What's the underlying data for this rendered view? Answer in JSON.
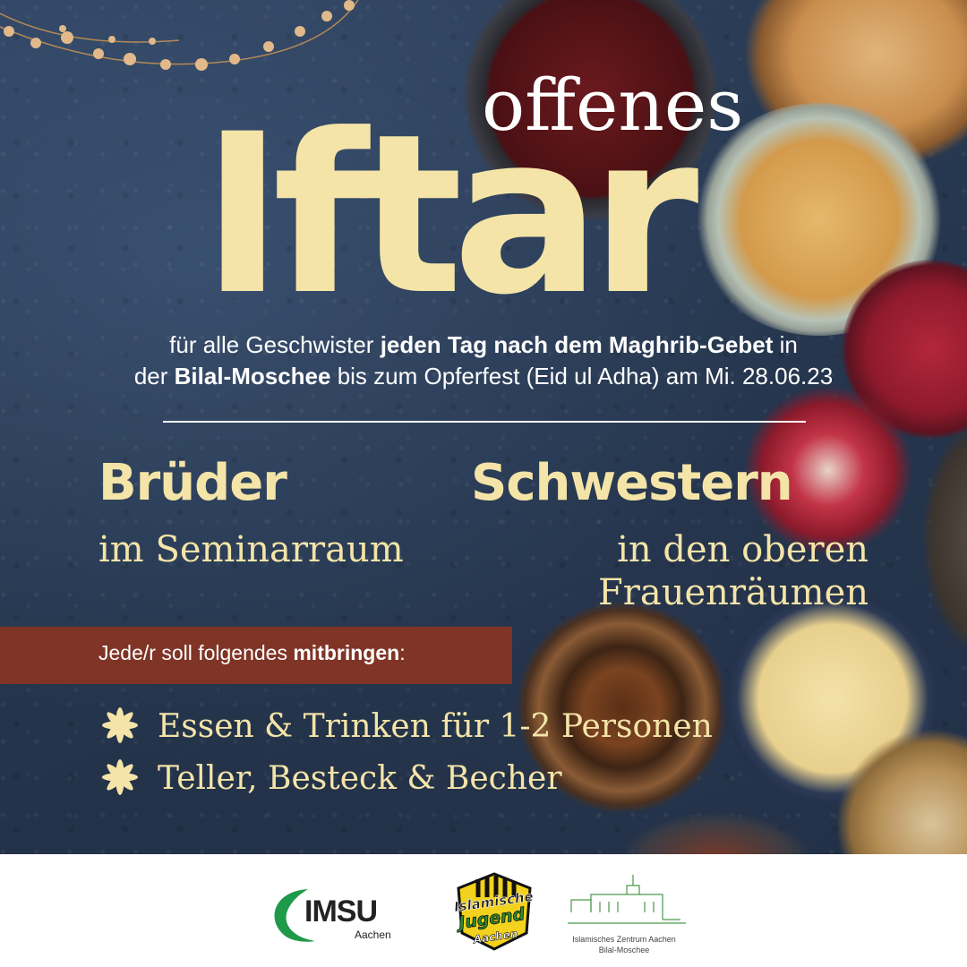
{
  "header": {
    "title_small": "offenes",
    "title_big": "Iftar"
  },
  "intro": {
    "line1_a": "für alle Geschwister ",
    "line1_b": "jeden Tag  nach dem Maghrib-Gebet",
    "line1_c": " in",
    "line2_a": "der ",
    "line2_b": "Bilal-Moschee",
    "line2_c": " bis zum Opferfest (Eid ul Adha) am Mi. 28.06.23"
  },
  "groups": {
    "brothers": {
      "title": "Brüder",
      "place": "im Seminarraum"
    },
    "sisters": {
      "title": "Schwestern",
      "place_line1": "in den oberen",
      "place_line2": "Frauenräumen"
    }
  },
  "bring": {
    "label_a": "Jede/r soll folgendes ",
    "label_b": "mitbringen",
    "label_c": ":",
    "items": [
      "Essen & Trinken für 1-2 Personen",
      "Teller, Besteck & Becher"
    ]
  },
  "footer": {
    "imsu_name": "IMSU",
    "imsu_city": "Aachen",
    "ij_logo_text": [
      "Islamische",
      "Jugend",
      "Aachen"
    ],
    "iz_line1": "Islamisches Zentrum Aachen",
    "iz_line2": "Bilal-Moschee"
  },
  "colors": {
    "background": "#26374f",
    "accent_yellow": "#f4e4a8",
    "bring_bar": "#7f3426",
    "imsu_green": "#1f9a4a",
    "ij_yellow": "#f2d21c"
  },
  "icons": [
    "string-lights-icon",
    "sparkle-bullet-icon",
    "imsu-logo",
    "islamische-jugend-logo",
    "mosque-logo"
  ]
}
